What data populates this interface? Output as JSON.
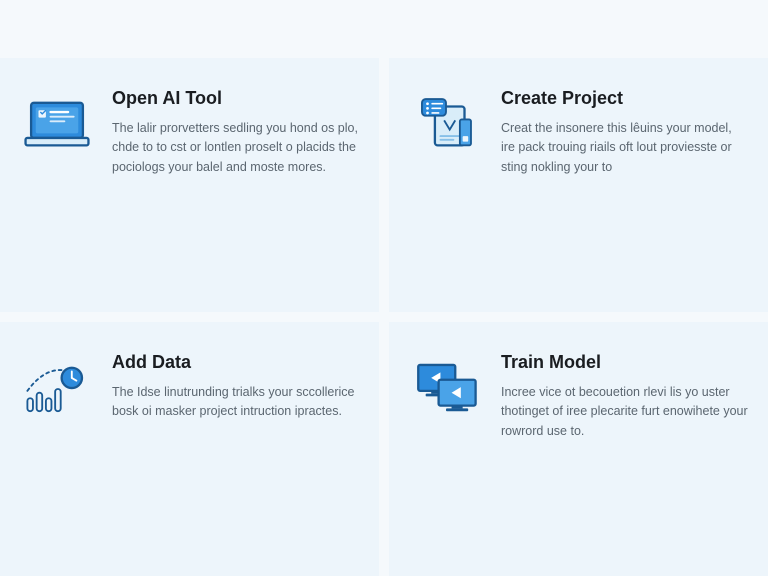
{
  "cards": [
    {
      "title": "Open AI Tool",
      "desc": "The lalir prorvetters sedling you hond os plo, chde to to cst or lontlen proselt o placids the pociologs your balel and moste mores."
    },
    {
      "title": "Create Project",
      "desc": "Creat the insonere this lêuins your model, ire pack trouing riails oft lout proviesste or sting nokling your to"
    },
    {
      "title": "Add Data",
      "desc": "The Idse linutrunding trialks your sccollerice bosk oi masker project intruction ipractes."
    },
    {
      "title": "Train Model",
      "desc": "Incree vice ot becouetion rlevi lis yo uster thotinget of iree plecarite furt enowihete your rowrord use to."
    }
  ]
}
